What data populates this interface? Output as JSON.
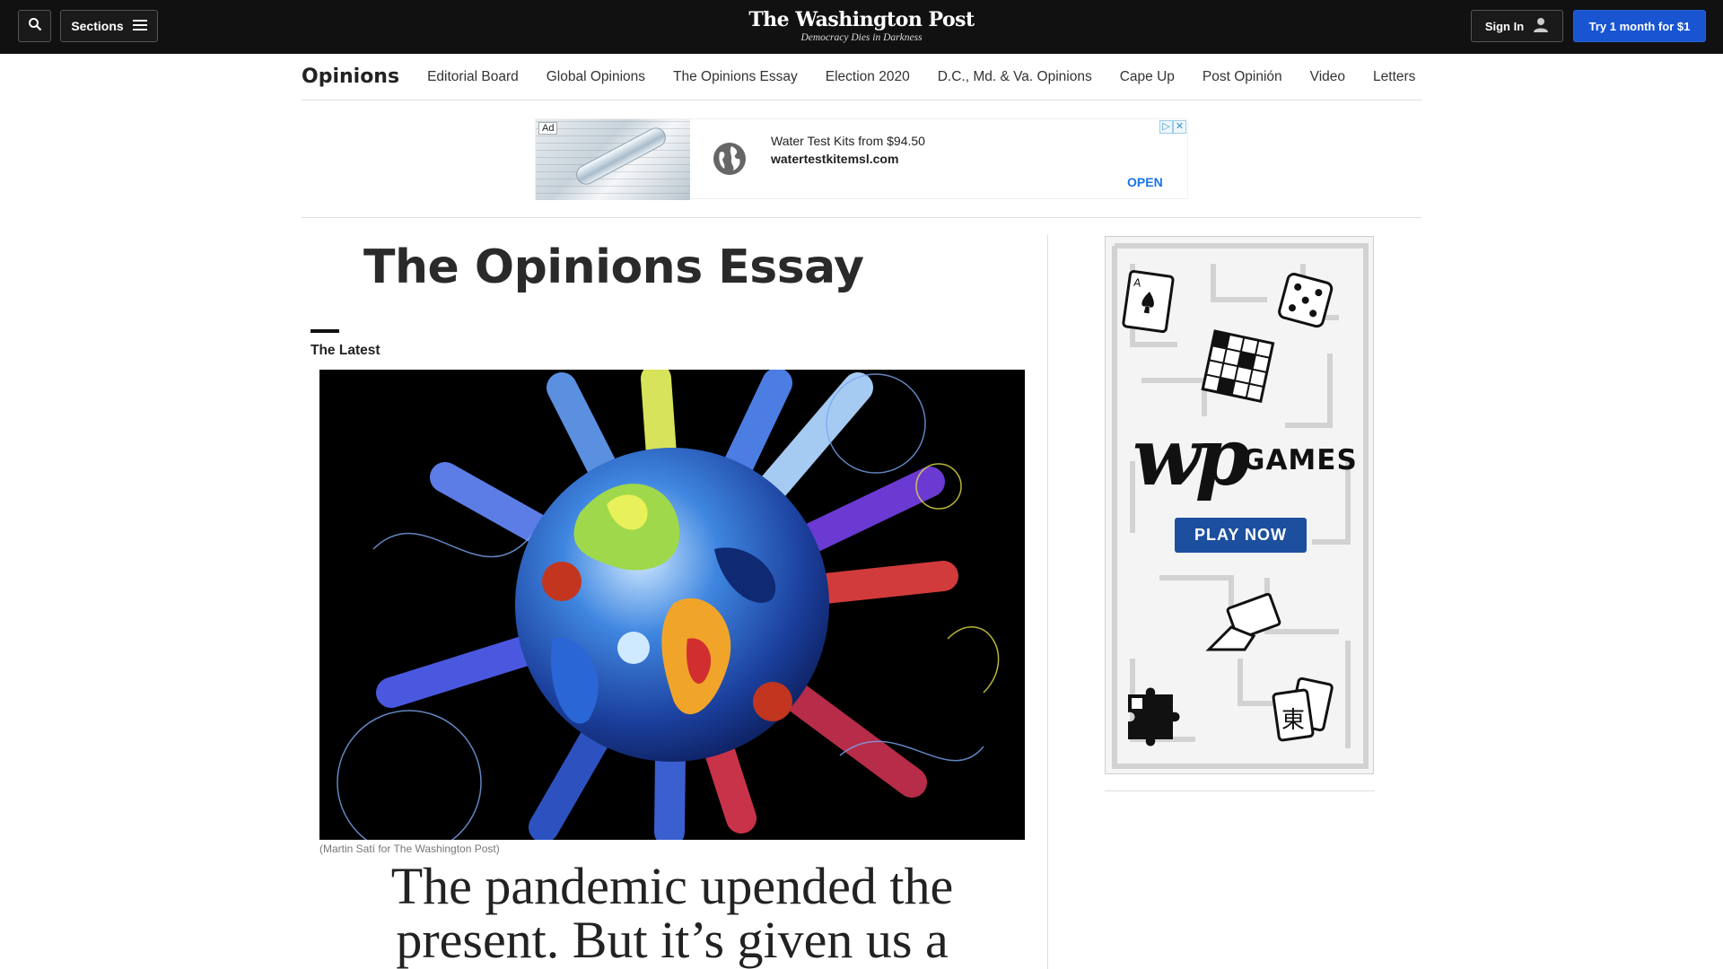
{
  "header": {
    "sections_label": "Sections",
    "logo_title": "The Washington Post",
    "logo_tagline": "Democracy Dies in Darkness",
    "signin_label": "Sign In",
    "subscribe_label": "Try 1 month for $1"
  },
  "section_nav": {
    "title": "Opinions",
    "items": [
      {
        "label": "Editorial Board"
      },
      {
        "label": "Global Opinions"
      },
      {
        "label": "The Opinions Essay"
      },
      {
        "label": "Election 2020"
      },
      {
        "label": "D.C., Md. & Va. Opinions"
      },
      {
        "label": "Cape Up"
      },
      {
        "label": "Post Opinión"
      },
      {
        "label": "Video"
      },
      {
        "label": "Letters"
      }
    ]
  },
  "ad_banner": {
    "badge": "Ad",
    "line1": "Water Test Kits from $94.50",
    "line2": "watertestkitemsl.com",
    "cta": "OPEN"
  },
  "main": {
    "page_title": "The Opinions Essay",
    "latest_label": "The Latest",
    "image_credit": "(Martin Satí for The Washington Post)",
    "headline": "The pandemic upended the present. But it’s given us a"
  },
  "rail_ad": {
    "logo": "wp",
    "games_label": "GAMES",
    "play_label": "PLAY NOW"
  },
  "colors": {
    "topbar_bg": "#111111",
    "subscribe_bg": "#1955d1",
    "play_btn_bg": "#1d4f9f",
    "ad_cta": "#1a73e8"
  }
}
